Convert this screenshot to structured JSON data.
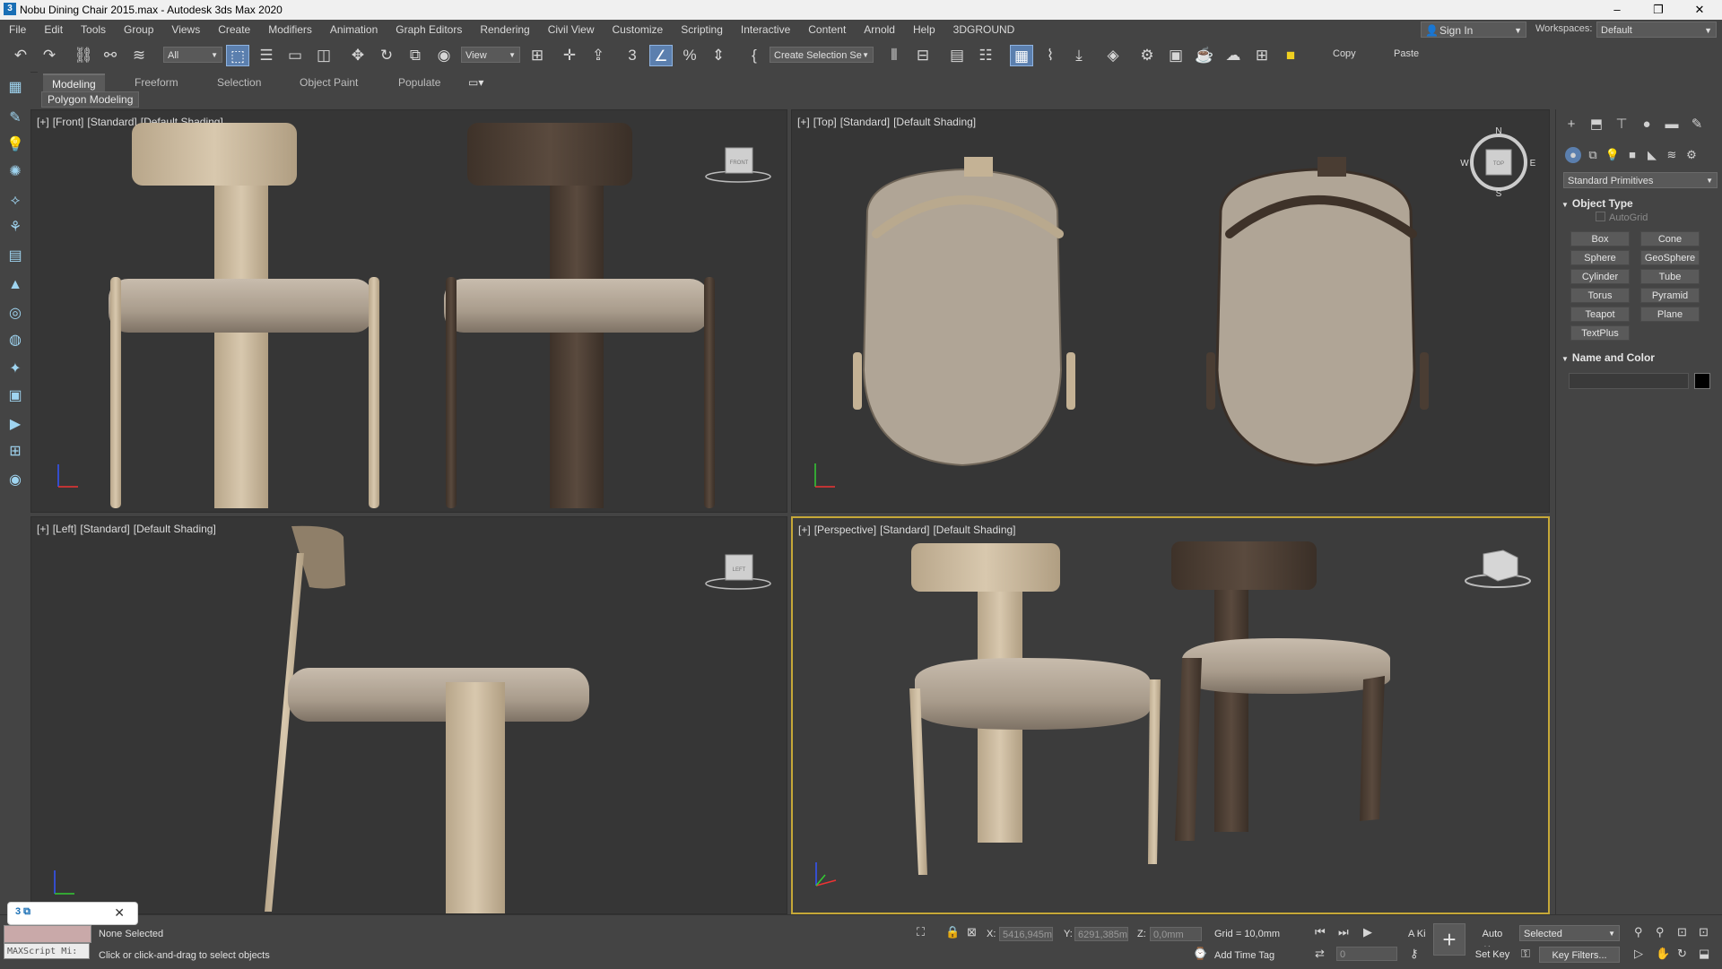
{
  "window": {
    "title": "Nobu Dining Chair 2015.max - Autodesk 3ds Max 2020",
    "app_icon": "3",
    "minimize": "–",
    "maximize": "❐",
    "close": "✕"
  },
  "menubar": {
    "items": [
      "File",
      "Edit",
      "Tools",
      "Group",
      "Views",
      "Create",
      "Modifiers",
      "Animation",
      "Graph Editors",
      "Rendering",
      "Civil View",
      "Customize",
      "Scripting",
      "Interactive",
      "Content",
      "Arnold",
      "Help",
      "3DGROUND"
    ],
    "sign_in": "Sign In",
    "workspaces_label": "Workspaces:",
    "workspace_value": "Default"
  },
  "toolbar": {
    "filter_value": "All",
    "ref_coord_value": "View",
    "selection_set_value": "Create Selection Se",
    "copy_label": "Copy",
    "paste_label": "Paste"
  },
  "ribbon": {
    "tabs": [
      "Modeling",
      "Freeform",
      "Selection",
      "Object Paint",
      "Populate"
    ],
    "active_tab": "Modeling",
    "sub_label": "Polygon Modeling"
  },
  "viewports": {
    "front": [
      "[+]",
      "[Front]",
      "[Standard]",
      "[Default Shading]"
    ],
    "top": [
      "[+]",
      "[Top]",
      "[Standard]",
      "[Default Shading]"
    ],
    "left": [
      "[+]",
      "[Left]",
      "[Standard]",
      "[Default Shading]"
    ],
    "perspective": [
      "[+]",
      "[Perspective]",
      "[Standard]",
      "[Default Shading]"
    ],
    "viewcube_front": "FRONT",
    "viewcube_left": "LEFT",
    "viewcube_top": "TOP",
    "compass": {
      "n": "N",
      "s": "S",
      "e": "E",
      "w": "W"
    }
  },
  "command_panel": {
    "category_dropdown": "Standard Primitives",
    "object_type_title": "Object Type",
    "autogrid_label": "AutoGrid",
    "buttons": [
      "Box",
      "Cone",
      "Sphere",
      "GeoSphere",
      "Cylinder",
      "Tube",
      "Torus",
      "Pyramid",
      "Teapot",
      "Plane",
      "TextPlus"
    ],
    "name_color_title": "Name and Color",
    "colors": {
      "object_color": "#000000"
    }
  },
  "status": {
    "selection": "None Selected",
    "prompt": "Click or click-and-drag to select objects",
    "maxscript_placeholder": "MAXScript Mi:",
    "x_label": "X:",
    "x_value": "5416,945m",
    "y_label": "Y:",
    "y_value": "6291,385m",
    "z_label": "Z:",
    "z_value": "0,0mm",
    "grid": "Grid = 10,0mm",
    "add_time_tag": "Add Time Tag",
    "auto_key": "Auto Key",
    "set_key": "Set Key",
    "selected_value": "Selected",
    "key_filters": "Key Filters...",
    "frame_value": "0",
    "ak_label": "A Ki"
  }
}
